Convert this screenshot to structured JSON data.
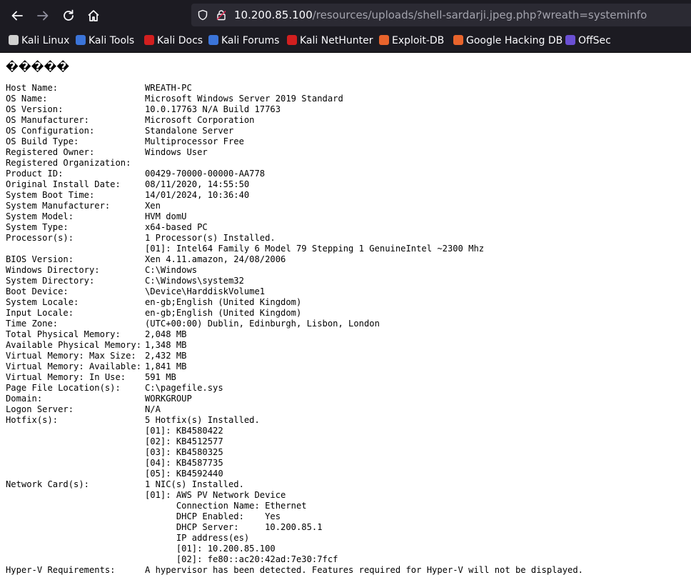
{
  "browser": {
    "url_host": "10.200.85.100",
    "url_path": "/resources/uploads/shell-sardarji.jpeg.php?wreath=systeminfo",
    "bookmarks": [
      {
        "label": "Kali Linux",
        "icon": "kali-dragon-icon",
        "color": "#d0d0d0"
      },
      {
        "label": "Kali Tools",
        "icon": "kali-tools-icon",
        "color": "#3b74d9"
      },
      {
        "label": "Kali Docs",
        "icon": "kali-docs-icon",
        "color": "#d21f1f"
      },
      {
        "label": "Kali Forums",
        "icon": "kali-forums-icon",
        "color": "#3b74d9"
      },
      {
        "label": "Kali NetHunter",
        "icon": "nethunter-icon",
        "color": "#d21f1f"
      },
      {
        "label": "Exploit-DB",
        "icon": "exploit-db-icon",
        "color": "#e8642c"
      },
      {
        "label": "Google Hacking DB",
        "icon": "ghdb-icon",
        "color": "#e8642c"
      },
      {
        "label": "OffSec",
        "icon": "offsec-icon",
        "color": "#6a4fd3"
      }
    ]
  },
  "page": {
    "garbled_header": "�����",
    "systeminfo": [
      {
        "key": "Host Name:",
        "value": "WREATH-PC"
      },
      {
        "key": "OS Name:",
        "value": "Microsoft Windows Server 2019 Standard"
      },
      {
        "key": "OS Version:",
        "value": "10.0.17763 N/A Build 17763"
      },
      {
        "key": "OS Manufacturer:",
        "value": "Microsoft Corporation"
      },
      {
        "key": "OS Configuration:",
        "value": "Standalone Server"
      },
      {
        "key": "OS Build Type:",
        "value": "Multiprocessor Free"
      },
      {
        "key": "Registered Owner:",
        "value": "Windows User"
      },
      {
        "key": "Registered Organization:",
        "value": ""
      },
      {
        "key": "Product ID:",
        "value": "00429-70000-00000-AA778"
      },
      {
        "key": "Original Install Date:",
        "value": "08/11/2020, 14:55:50"
      },
      {
        "key": "System Boot Time:",
        "value": "14/01/2024, 10:36:40"
      },
      {
        "key": "System Manufacturer:",
        "value": "Xen"
      },
      {
        "key": "System Model:",
        "value": "HVM domU"
      },
      {
        "key": "System Type:",
        "value": "x64-based PC"
      },
      {
        "key": "Processor(s):",
        "value": "1 Processor(s) Installed."
      },
      {
        "key": "",
        "value": "[01]: Intel64 Family 6 Model 79 Stepping 1 GenuineIntel ~2300 Mhz"
      },
      {
        "key": "BIOS Version:",
        "value": "Xen 4.11.amazon, 24/08/2006"
      },
      {
        "key": "Windows Directory:",
        "value": "C:\\Windows"
      },
      {
        "key": "System Directory:",
        "value": "C:\\Windows\\system32"
      },
      {
        "key": "Boot Device:",
        "value": "\\Device\\HarddiskVolume1"
      },
      {
        "key": "System Locale:",
        "value": "en-gb;English (United Kingdom)"
      },
      {
        "key": "Input Locale:",
        "value": "en-gb;English (United Kingdom)"
      },
      {
        "key": "Time Zone:",
        "value": "(UTC+00:00) Dublin, Edinburgh, Lisbon, London"
      },
      {
        "key": "Total Physical Memory:",
        "value": "2,048 MB"
      },
      {
        "key": "Available Physical Memory:",
        "value": "1,348 MB"
      },
      {
        "key": "Virtual Memory: Max Size:",
        "value": "2,432 MB"
      },
      {
        "key": "Virtual Memory: Available:",
        "value": "1,841 MB"
      },
      {
        "key": "Virtual Memory: In Use:",
        "value": "591 MB"
      },
      {
        "key": "Page File Location(s):",
        "value": "C:\\pagefile.sys"
      },
      {
        "key": "Domain:",
        "value": "WORKGROUP"
      },
      {
        "key": "Logon Server:",
        "value": "N/A"
      },
      {
        "key": "Hotfix(s):",
        "value": "5 Hotfix(s) Installed."
      },
      {
        "key": "",
        "value": "[01]: KB4580422"
      },
      {
        "key": "",
        "value": "[02]: KB4512577"
      },
      {
        "key": "",
        "value": "[03]: KB4580325"
      },
      {
        "key": "",
        "value": "[04]: KB4587735"
      },
      {
        "key": "",
        "value": "[05]: KB4592440"
      },
      {
        "key": "Network Card(s):",
        "value": "1 NIC(s) Installed."
      },
      {
        "key": "",
        "value": "[01]: AWS PV Network Device"
      },
      {
        "key": "",
        "value": "      Connection Name: Ethernet"
      },
      {
        "key": "",
        "value": "      DHCP Enabled:    Yes"
      },
      {
        "key": "",
        "value": "      DHCP Server:     10.200.85.1"
      },
      {
        "key": "",
        "value": "      IP address(es)"
      },
      {
        "key": "",
        "value": "      [01]: 10.200.85.100"
      },
      {
        "key": "",
        "value": "      [02]: fe80::ac20:42ad:7e30:7fcf"
      },
      {
        "key": "Hyper-V Requirements:",
        "value": "A hypervisor has been detected. Features required for Hyper-V will not be displayed."
      }
    ]
  }
}
